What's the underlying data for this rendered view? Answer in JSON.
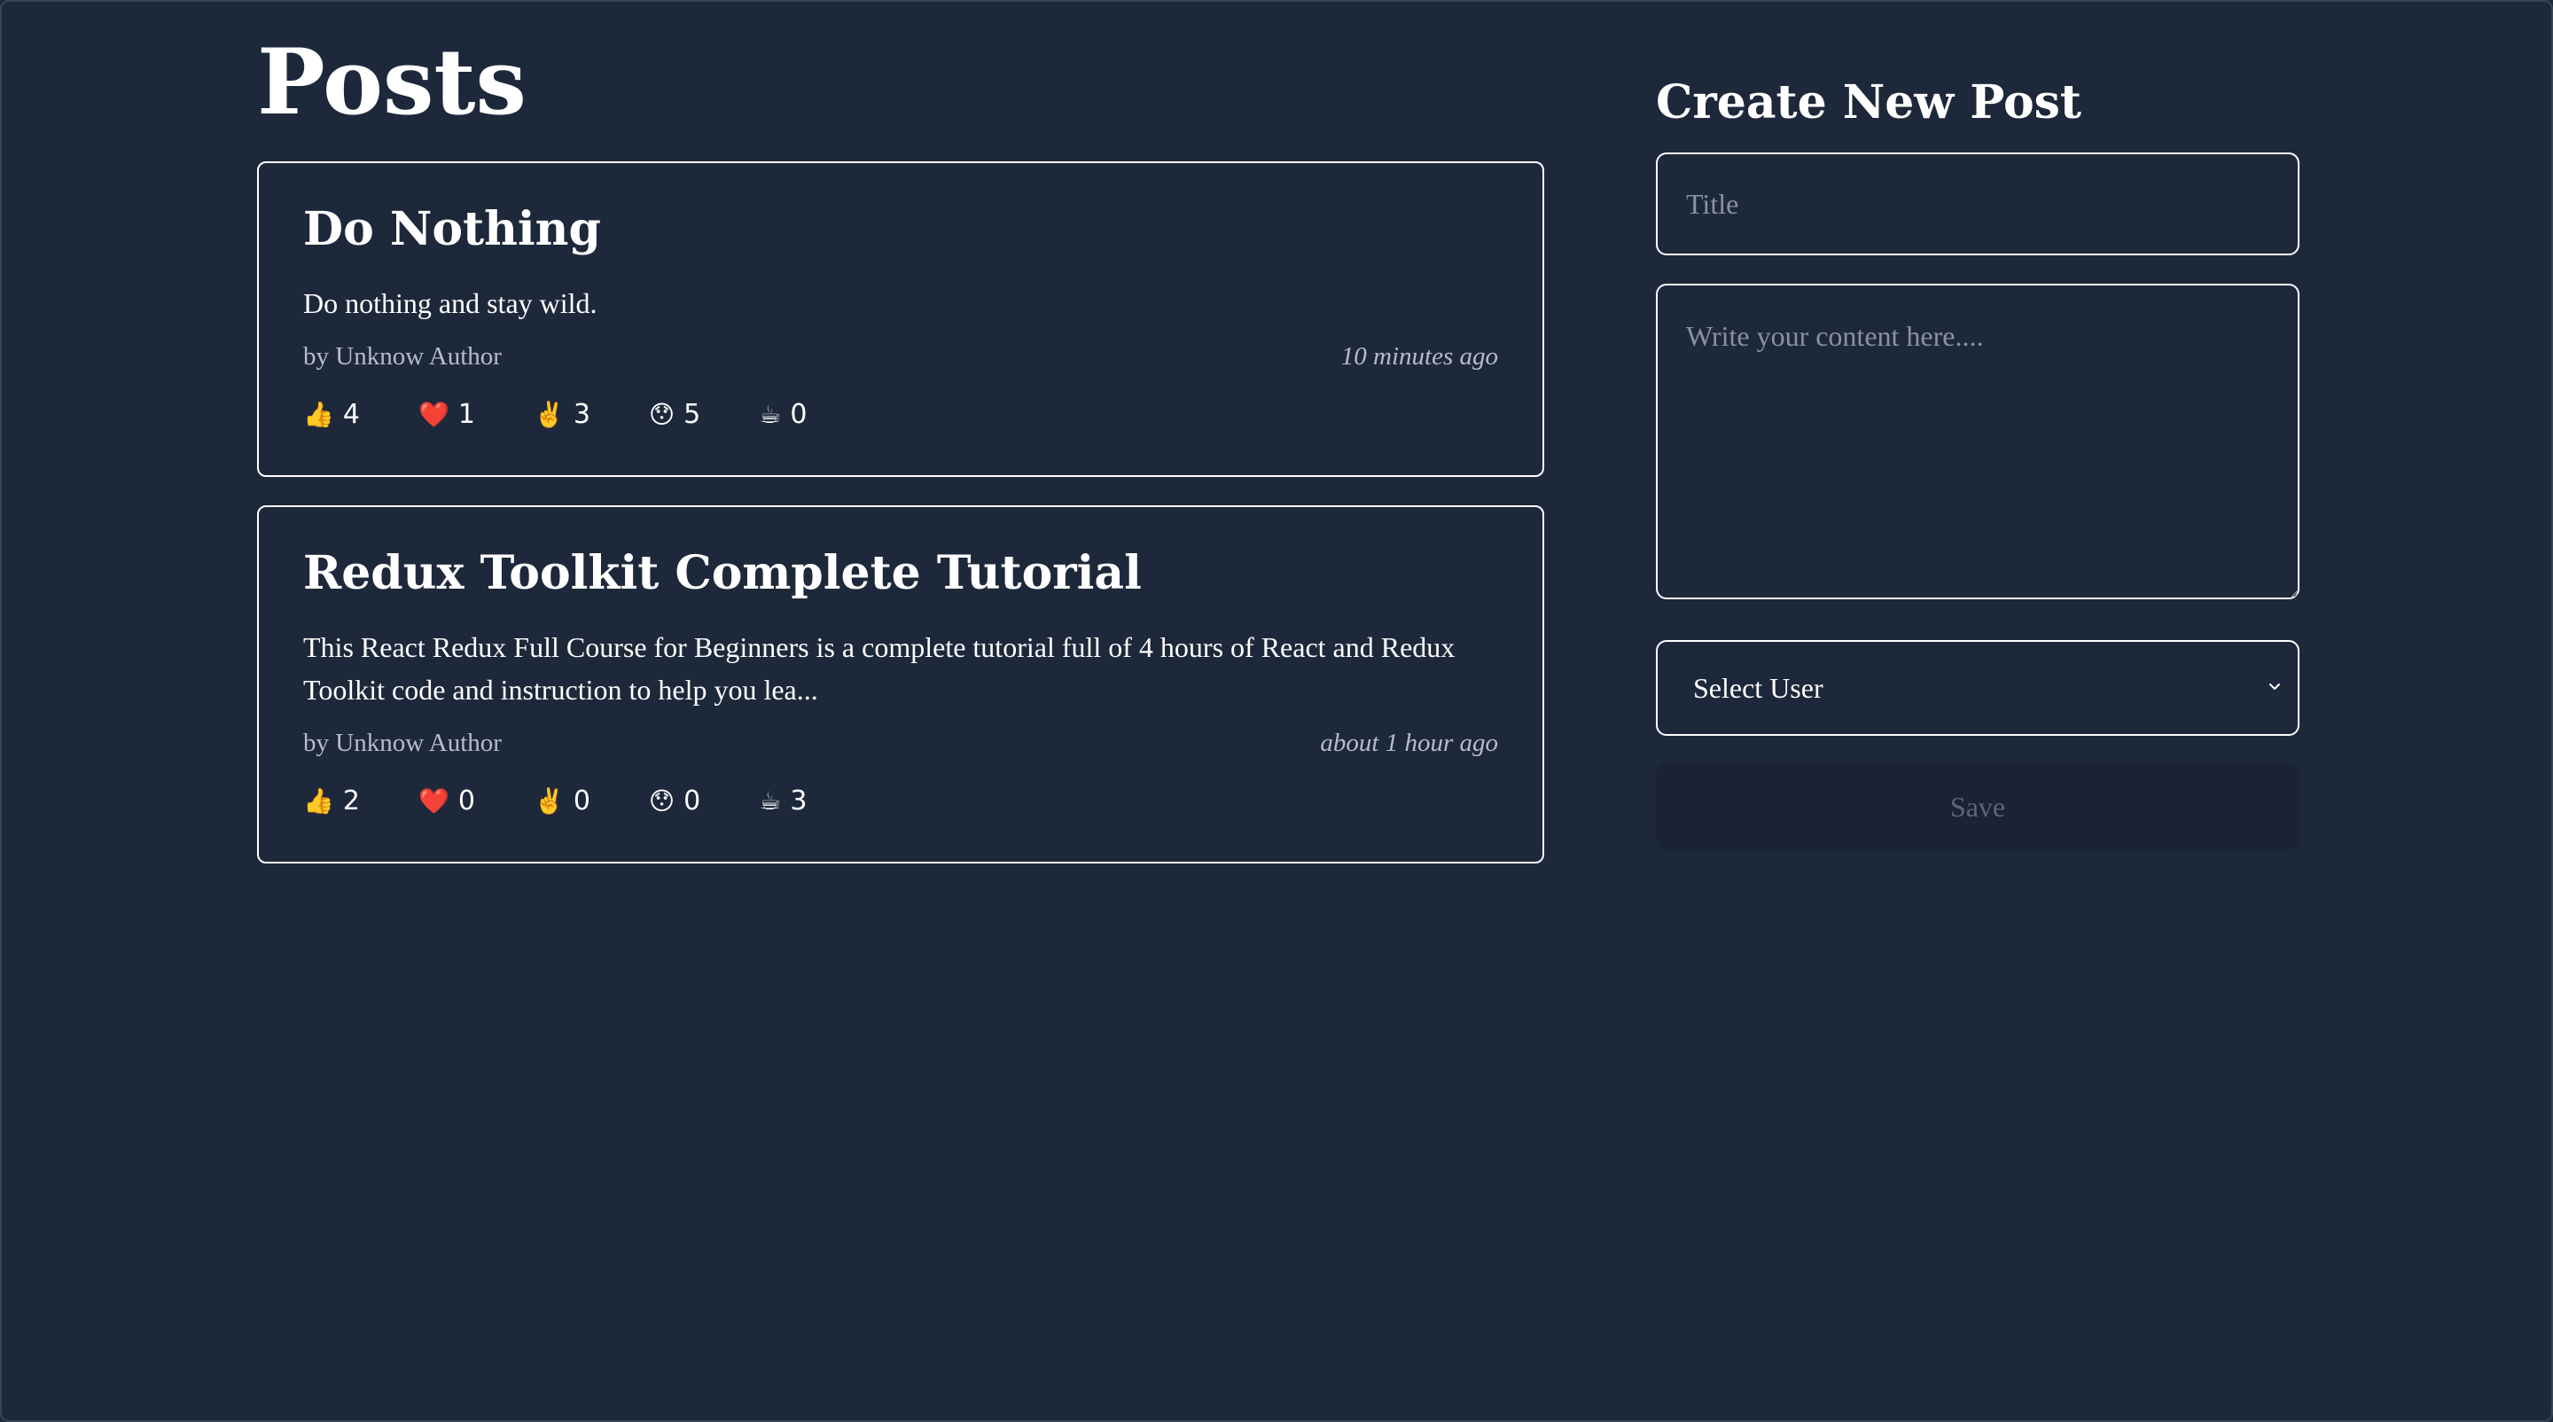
{
  "page": {
    "title": "Posts"
  },
  "posts": [
    {
      "title": "Do Nothing",
      "body": "Do nothing and stay wild.",
      "author": "by Unknow Author",
      "time": "10 minutes ago",
      "reactions": [
        {
          "icon": "thumbs-up-icon",
          "emoji": "👍",
          "count": "4"
        },
        {
          "icon": "heart-icon",
          "emoji": "❤️",
          "count": "1"
        },
        {
          "icon": "victory-hand-icon",
          "emoji": "✌️",
          "count": "3"
        },
        {
          "icon": "hushed-face-icon",
          "emoji": "😯",
          "count": "5"
        },
        {
          "icon": "coffee-icon",
          "emoji": "☕",
          "count": "0"
        }
      ]
    },
    {
      "title": "Redux Toolkit Complete Tutorial",
      "body": "This React Redux Full Course for Beginners is a complete tutorial full of 4 hours of React and Redux Toolkit code and instruction to help you lea...",
      "author": "by Unknow Author",
      "time": "about 1 hour ago",
      "reactions": [
        {
          "icon": "thumbs-up-icon",
          "emoji": "👍",
          "count": "2"
        },
        {
          "icon": "heart-icon",
          "emoji": "❤️",
          "count": "0"
        },
        {
          "icon": "victory-hand-icon",
          "emoji": "✌️",
          "count": "0"
        },
        {
          "icon": "hushed-face-icon",
          "emoji": "😯",
          "count": "0"
        },
        {
          "icon": "coffee-icon",
          "emoji": "☕",
          "count": "3"
        }
      ]
    }
  ],
  "form": {
    "title": "Create New Post",
    "title_placeholder": "Title",
    "title_value": "",
    "content_placeholder": "Write your content here....",
    "content_value": "",
    "user_select_label": "Select User",
    "save_label": "Save"
  },
  "colors": {
    "background": "#1e283b",
    "border": "#ffffff",
    "muted_text": "#b6bdc9",
    "placeholder": "#8a92a1",
    "disabled_button_bg": "#1a2335",
    "disabled_button_text": "#5d6678"
  }
}
